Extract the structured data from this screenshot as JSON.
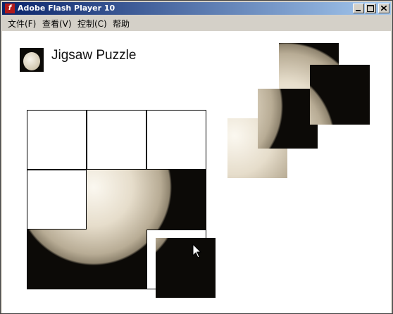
{
  "window": {
    "title": "Adobe Flash Player 10",
    "icon": "flash-icon"
  },
  "menu": {
    "file": "文件(F)",
    "view": "查看(V)",
    "control": "控制(C)",
    "help": "帮助"
  },
  "game": {
    "title": "Jigsaw Puzzle",
    "board": {
      "columns": 3,
      "rows": 3
    },
    "placed_pieces": 4,
    "empty_slots": 5,
    "loose_pieces": 5
  }
}
